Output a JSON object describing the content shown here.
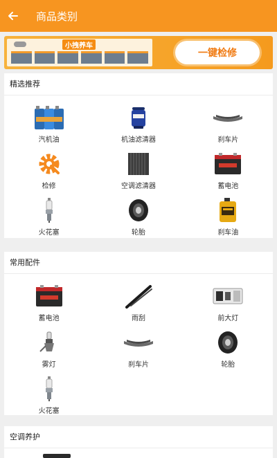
{
  "header": {
    "title": "商品类别"
  },
  "banner": {
    "sign": "小拽养车",
    "cta": "一键检修"
  },
  "sections": [
    {
      "title": "精选推荐",
      "items": [
        {
          "label": "汽机油",
          "icon": "engine-oil-icon"
        },
        {
          "label": "机油滤清器",
          "icon": "oil-filter-icon"
        },
        {
          "label": "刹车片",
          "icon": "brake-pad-icon"
        },
        {
          "label": "检修",
          "icon": "repair-gear-icon"
        },
        {
          "label": "空调滤清器",
          "icon": "ac-filter-icon"
        },
        {
          "label": "蓄电池",
          "icon": "battery-icon"
        },
        {
          "label": "火花塞",
          "icon": "spark-plug-icon"
        },
        {
          "label": "轮胎",
          "icon": "tire-icon"
        },
        {
          "label": "刹车油",
          "icon": "brake-fluid-icon"
        }
      ]
    },
    {
      "title": "常用配件",
      "items": [
        {
          "label": "蓄电池",
          "icon": "battery-icon"
        },
        {
          "label": "雨刮",
          "icon": "wiper-icon"
        },
        {
          "label": "前大灯",
          "icon": "headlight-icon"
        },
        {
          "label": "雾灯",
          "icon": "fog-lamp-icon"
        },
        {
          "label": "刹车片",
          "icon": "brake-pad-icon"
        },
        {
          "label": "轮胎",
          "icon": "tire-icon"
        },
        {
          "label": "火花塞",
          "icon": "spark-plug-icon"
        }
      ]
    },
    {
      "title": "空调养护",
      "items": []
    }
  ],
  "colors": {
    "accent": "#f79520",
    "background": "#efefef",
    "card": "#ffffff"
  }
}
